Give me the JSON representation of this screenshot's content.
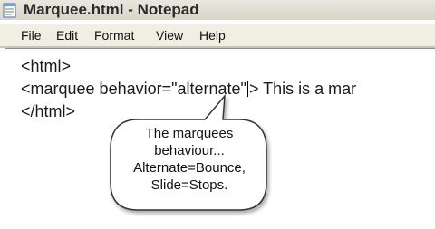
{
  "window": {
    "title": "Marquee.html - Notepad"
  },
  "menu": [
    "File",
    "Edit",
    "Format",
    "View",
    "Help"
  ],
  "editor": {
    "line1": "<html>",
    "line2_before_caret": "<marquee behavior=\"alternate\"",
    "line2_after_caret": "> This is a mar",
    "line3": "</html>"
  },
  "callout": {
    "lines": [
      "The marquees",
      "behaviour...",
      "Alternate=Bounce,",
      "Slide=Stops."
    ]
  },
  "colors": {
    "titlebar": "#d9d6c8",
    "menubar": "#f1efe3",
    "editor_bg": "#ffffff"
  }
}
